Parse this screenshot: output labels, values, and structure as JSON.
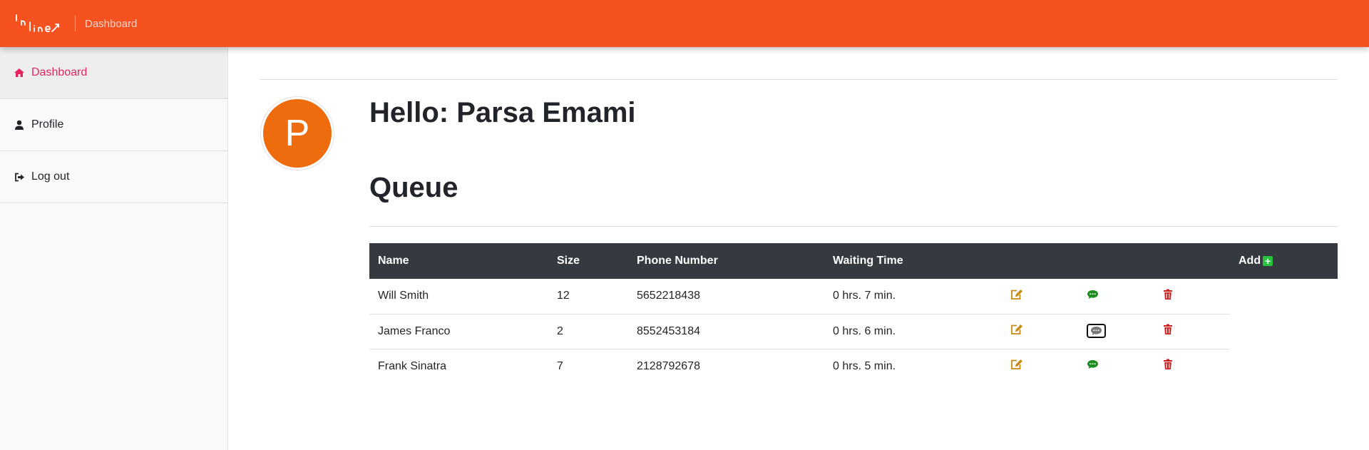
{
  "topbar": {
    "logo_text": "Inline",
    "crumb": "Dashboard",
    "color": "#f55220"
  },
  "sidebar": {
    "items": [
      {
        "label": "Dashboard",
        "icon": "home-icon",
        "active": true
      },
      {
        "label": "Profile",
        "icon": "user-icon",
        "active": false
      },
      {
        "label": "Log out",
        "icon": "sign-out-icon",
        "active": false
      }
    ]
  },
  "profile": {
    "avatar_letter": "P",
    "avatar_color": "#ee6c0e",
    "greeting": "Hello:",
    "name": "Parsa Emami"
  },
  "queue": {
    "title": "Queue",
    "headers": {
      "name": "Name",
      "size": "Size",
      "phone": "Phone Number",
      "waiting": "Waiting Time",
      "add": "Add"
    },
    "rows": [
      {
        "name": "Will Smith",
        "size": "12",
        "phone": "5652218438",
        "waiting": "0 hrs. 7 min.",
        "message_state": "default"
      },
      {
        "name": "James Franco",
        "size": "2",
        "phone": "8552453184",
        "waiting": "0 hrs. 6 min.",
        "message_state": "sent"
      },
      {
        "name": "Frank Sinatra",
        "size": "7",
        "phone": "2128792678",
        "waiting": "0 hrs. 5 min.",
        "message_state": "default"
      }
    ],
    "icons": {
      "edit": "edit-icon",
      "message": "comment-icon",
      "delete": "trash-icon",
      "add": "plus-square-icon"
    },
    "colors": {
      "edit": "#c98a12",
      "message": "#1e8c1e",
      "message_sent": "#777777",
      "delete": "#cc1f1f",
      "add": "#28c33c",
      "header_bg": "#343a40"
    }
  }
}
